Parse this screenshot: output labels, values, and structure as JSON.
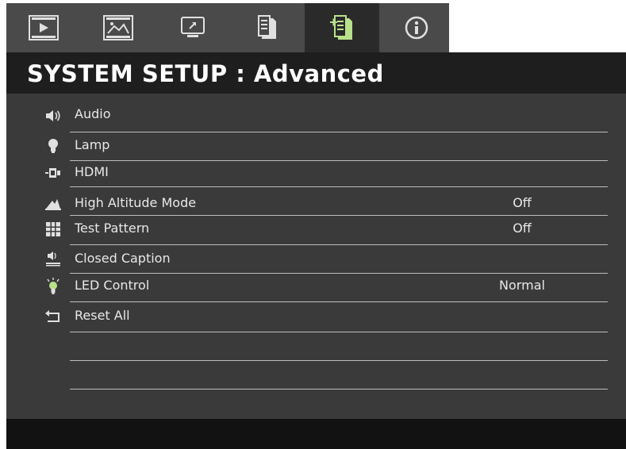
{
  "tabs": [
    {
      "icon": "video-icon"
    },
    {
      "icon": "image-icon"
    },
    {
      "icon": "display-icon"
    },
    {
      "icon": "setup-basic-icon"
    },
    {
      "icon": "setup-advanced-icon",
      "active": true
    },
    {
      "icon": "info-icon"
    }
  ],
  "header": {
    "title": "SYSTEM SETUP : Advanced"
  },
  "menu": {
    "items": [
      {
        "label": "Audio",
        "value": "",
        "icon": "audio-icon"
      },
      {
        "label": "Lamp",
        "value": "",
        "icon": "lamp-icon"
      },
      {
        "label": "HDMI",
        "value": "",
        "icon": "hdmi-icon"
      },
      {
        "label": "High Altitude Mode",
        "value": "Off",
        "icon": "altitude-icon"
      },
      {
        "label": "Test Pattern",
        "value": "Off",
        "icon": "test-pattern-icon"
      },
      {
        "label": "Closed Caption",
        "value": "",
        "icon": "closed-caption-icon"
      },
      {
        "label": "LED Control",
        "value": "Normal",
        "icon": "led-icon"
      },
      {
        "label": "Reset All",
        "value": "",
        "icon": "reset-icon"
      }
    ]
  },
  "colors": {
    "accent": "#b9e08a",
    "background": "#3a3a3a",
    "title_bar": "#1e1e1e"
  }
}
